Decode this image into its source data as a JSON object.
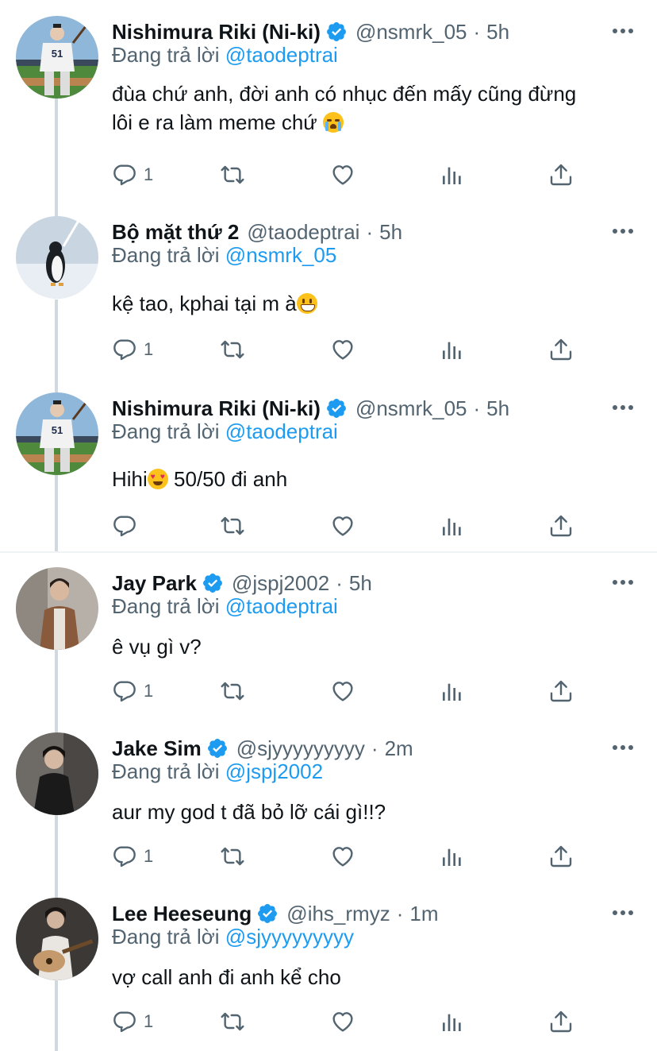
{
  "reply_prefix": "Đang trả lời",
  "accent_color": "#1d9bf0",
  "tweets": [
    {
      "name": "Nishimura Riki (Ni-ki)",
      "verified": true,
      "handle": "@nsmrk_05",
      "time": "5h",
      "reply_to": "@taodeptrai",
      "text_line1": "đùa chứ anh, đời anh có nhục đến mấy cũng đừng",
      "text_line2": "lôi e ra làm meme chứ",
      "emoji": "crying-face",
      "reply_count": "1",
      "avatar": "baseball-player-51"
    },
    {
      "name": "Bộ mặt thứ 2",
      "verified": false,
      "handle": "@taodeptrai",
      "time": "5h",
      "reply_to": "@nsmrk_05",
      "text_line1": "kệ tao, kphai tại m à",
      "emoji": "grinning-face",
      "reply_count": "1",
      "avatar": "penguin-on-ice"
    },
    {
      "name": "Nishimura Riki (Ni-ki)",
      "verified": true,
      "handle": "@nsmrk_05",
      "time": "5h",
      "reply_to": "@taodeptrai",
      "text_line1_a": "Hihi",
      "text_line1_b": " 50/50 đi anh",
      "emoji": "heart-eyes-face",
      "reply_count": "",
      "avatar": "baseball-player-51"
    },
    {
      "name": "Jay Park",
      "verified": true,
      "handle": "@jspj2002",
      "time": "5h",
      "reply_to": "@taodeptrai",
      "text_line1": "ê vụ gì v?",
      "reply_count": "1",
      "avatar": "man-in-suit"
    },
    {
      "name": "Jake Sim",
      "verified": true,
      "handle": "@sjyyyyyyyyy",
      "time": "2m",
      "reply_to": "@jspj2002",
      "text_line1": "aur my god t đã bỏ lỡ cái gì!!?",
      "reply_count": "1",
      "avatar": "man-dark-coat"
    },
    {
      "name": "Lee Heeseung",
      "verified": true,
      "handle": "@ihs_rmyz",
      "time": "1m",
      "reply_to": "@sjyyyyyyyyy",
      "text_line1": "vợ call anh đi anh kể cho",
      "reply_count": "1",
      "avatar": "man-with-guitar"
    }
  ]
}
